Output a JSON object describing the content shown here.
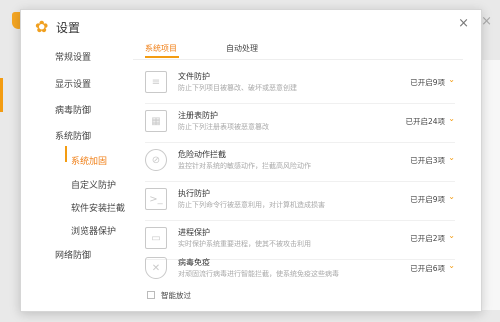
{
  "window": {
    "title": "设置",
    "close_glyph": "×",
    "bg_close_glyph": "×"
  },
  "sidebar": {
    "items": [
      {
        "label": "常规设置"
      },
      {
        "label": "显示设置"
      },
      {
        "label": "病毒防御"
      },
      {
        "label": "系统防御"
      },
      {
        "label": "网络防御"
      }
    ],
    "subitems": [
      {
        "label": "系统加固",
        "active": true
      },
      {
        "label": "自定义防护"
      },
      {
        "label": "软件安装拦截"
      },
      {
        "label": "浏览器保护"
      }
    ]
  },
  "tabs": [
    {
      "label": "系统项目",
      "active": true
    },
    {
      "label": "自动处理"
    }
  ],
  "rows": [
    {
      "icon": "document-icon",
      "glyph": "≡",
      "name": "文件防护",
      "desc": "防止下列项目被篡改、破坏或恶意创建",
      "status": "已开启9项"
    },
    {
      "icon": "grid-icon",
      "glyph": "▦",
      "name": "注册表防护",
      "desc": "防止下列注册表项被恶意篡改",
      "status": "已开启24项"
    },
    {
      "icon": "block-icon",
      "glyph": "⊘",
      "name": "危险动作拦截",
      "desc": "监控针对系统的敏感动作，拦截高风险动作",
      "status": "已开启3项"
    },
    {
      "icon": "terminal-icon",
      "glyph": ">_",
      "name": "执行防护",
      "desc": "防止下列命令行被恶意利用，对计算机造成损害",
      "status": "已开启9项"
    },
    {
      "icon": "process-icon",
      "glyph": "▭",
      "name": "进程保护",
      "desc": "实时保护系统重要进程，使其不被攻击利用",
      "status": "已开启2项"
    },
    {
      "icon": "shield-virus-icon",
      "glyph": "✕",
      "name": "病毒免疫",
      "desc": "对顽固流行病毒进行智能拦截，使系统免疫这些病毒",
      "status": "已开启6项"
    }
  ],
  "chevron_glyph": "⌄",
  "smart_release": {
    "label": "智能放过",
    "checked": false
  },
  "colors": {
    "accent": "#f39c12",
    "active_text": "#f07e14"
  }
}
